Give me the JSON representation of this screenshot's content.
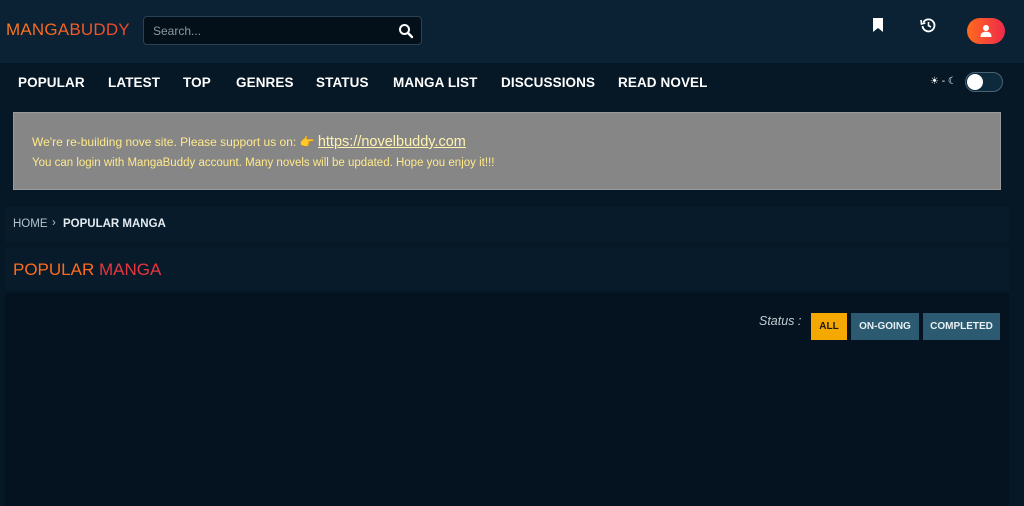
{
  "header": {
    "logo": "MANGABUDDY",
    "search_placeholder": "Search...",
    "icons": [
      "search-icon",
      "bookmark-icon",
      "history-icon",
      "user-icon"
    ]
  },
  "nav": {
    "items": [
      "POPULAR",
      "LATEST",
      "TOP",
      "GENRES",
      "STATUS",
      "MANGA LIST",
      "DISCUSSIONS",
      "READ NOVEL"
    ],
    "theme_label": "☀ - ☾"
  },
  "notice": {
    "line1_text": "We're re-building nove site. Please support us on: 👉",
    "link": "https://novelbuddy.com",
    "line2": "You can login with MangaBuddy account. Many novels will be updated. Hope you enjoy it!!!"
  },
  "breadcrumb": {
    "home": "HOME",
    "separator": "›",
    "current": "POPULAR MANGA"
  },
  "page": {
    "title_part1": "POPULAR ",
    "title_part2": "MANGA"
  },
  "filters": {
    "label": "Status :",
    "all": "ALL",
    "ongoing": "ON-GOING",
    "completed": "COMPLETED",
    "selected": "ALL"
  },
  "colors": {
    "accent_orange": "#ff6a1e",
    "accent_red": "#e8353f",
    "active_filter": "#f5a800",
    "filter_button": "#2c5a70",
    "notice_bg": "#868686",
    "page_bg": "#061725"
  }
}
